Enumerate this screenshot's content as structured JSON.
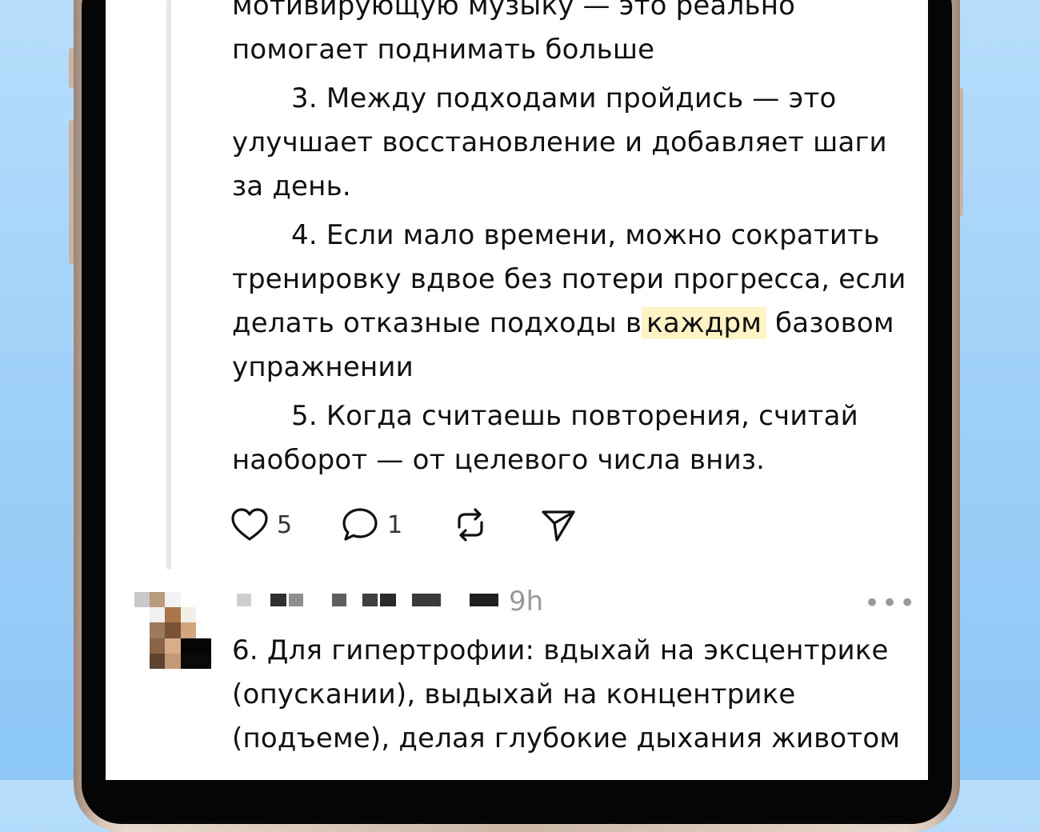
{
  "post1": {
    "text_line1": "мотивирующую музыку — это реально",
    "text_line2": "помогает поднимать больше",
    "item3": "3. Между подходами пройдись — это улучшает восстановление и добавляет шаги за день.",
    "item4_before": "4. Если мало времени, можно сократить тренировку вдвое без потери прогресса, если делать отказные подходы в",
    "item4_highlight": "каждрм",
    "item4_after": "базовом упражнении",
    "item5": "5. Когда считаешь повторения, считай наоборот — от целевого числа вниз.",
    "likes": "5",
    "comments": "1"
  },
  "post2": {
    "time": "9h",
    "more": "•••",
    "text": "6. Для гипертрофии: вдыхай на эксцентрике (опускании), выдыхай на концентрике (подъеме), делая глубокие дыхания животом"
  },
  "icons": {
    "like": "heart-icon",
    "comment": "comment-bubble-icon",
    "repost": "repost-icon",
    "share": "send-icon",
    "more": "more-dots-icon"
  },
  "colors": {
    "highlight": "#fdf3c4",
    "text": "#111111",
    "muted": "#999999",
    "background_gradient_top": "#b7ddfb",
    "background_gradient_bottom": "#8cc7f6"
  }
}
